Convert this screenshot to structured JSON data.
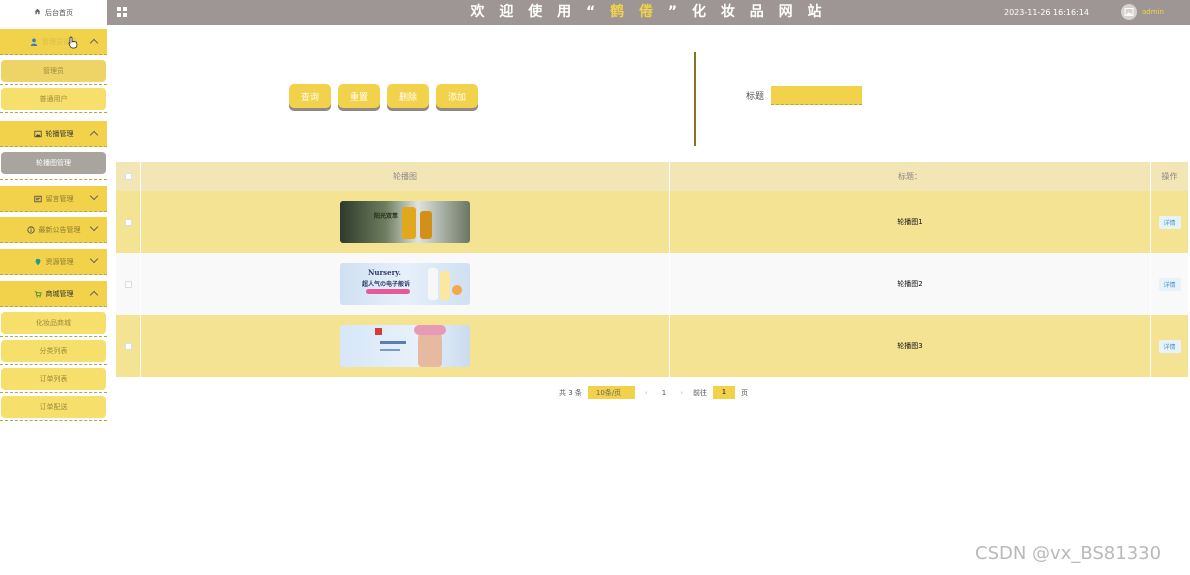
{
  "header": {
    "title_prefix": "欢 迎 使 用 “",
    "title_brand": " 鹤 倦 ",
    "title_suffix": "” 化 妆 品 网 站",
    "datetime": "2023-11-26 16:16:14",
    "username": "admin"
  },
  "sidebar": {
    "home": "后台首页",
    "groups": [
      {
        "label": "管理员管理",
        "expanded": true,
        "subitems": [
          "管理员",
          "普通用户"
        ]
      },
      {
        "label": "轮播管理",
        "expanded": true,
        "subitems": [
          "轮播图管理"
        ]
      },
      {
        "label": "留言管理",
        "expanded": false,
        "subitems": []
      },
      {
        "label": "最新公告管理",
        "expanded": false,
        "subitems": []
      },
      {
        "label": "资源管理",
        "expanded": false,
        "subitems": []
      },
      {
        "label": "商城管理",
        "expanded": true,
        "subitems": [
          "化妆品商城",
          "分类列表",
          "订单列表",
          "订单配送"
        ]
      }
    ]
  },
  "toolbar": {
    "query": "查询",
    "reset": "重置",
    "delete": "删除",
    "add": "添加"
  },
  "search": {
    "label": "标题",
    "value": ""
  },
  "table": {
    "headers": {
      "image": "轮播图",
      "title": "标题：",
      "actions": "操作"
    },
    "rows": [
      {
        "title": "轮播图1",
        "action": "详情",
        "banner_text": "阳光双萃"
      },
      {
        "title": "轮播图2",
        "action": "详情",
        "banner_text": "Nursery.",
        "banner_text2": "超人气の电子般诉"
      },
      {
        "title": "轮播图3",
        "action": "详情"
      }
    ]
  },
  "pagination": {
    "total": "共 3 条",
    "page_size": "10条/页",
    "current_page": "1",
    "goto_prefix": "前往",
    "goto_value": "1",
    "goto_suffix": "页"
  },
  "watermark": "CSDN @vx_BS81330",
  "colors": {
    "accent": "#f2d24a",
    "header_bg": "#9d9694",
    "row_highlight": "#f4e392"
  }
}
